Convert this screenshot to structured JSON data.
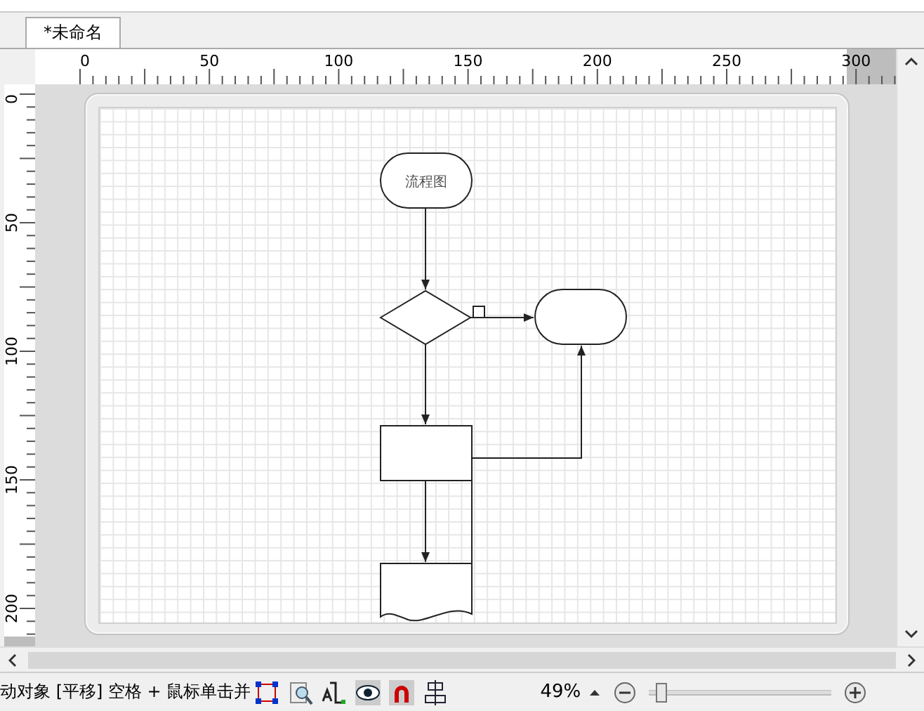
{
  "document_tab": {
    "title": "*未命名",
    "selected": true
  },
  "ruler_h": {
    "labels": [
      "0",
      "50",
      "100",
      "150",
      "200",
      "250",
      "300"
    ]
  },
  "ruler_v": {
    "labels": [
      "0",
      "50",
      "100",
      "150",
      "200"
    ]
  },
  "diagram": {
    "nodes": [
      {
        "kind": "terminal",
        "label": "流程图"
      },
      {
        "kind": "decision"
      },
      {
        "kind": "terminal"
      },
      {
        "kind": "process"
      },
      {
        "kind": "document"
      }
    ]
  },
  "status_bar": {
    "hint": "动对象 [平移] 空格 + 鼠标单击并",
    "zoom": "49%",
    "zoom_slider": {
      "level": 0.04
    }
  }
}
